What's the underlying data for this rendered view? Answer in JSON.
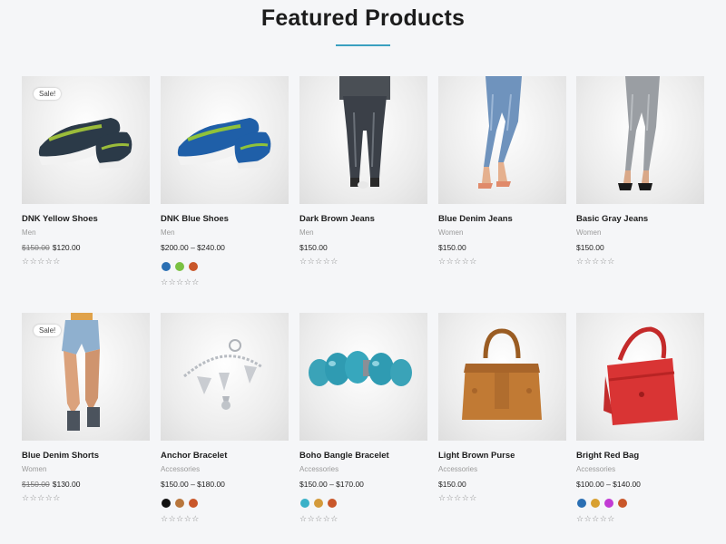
{
  "section": {
    "title": "Featured Products"
  },
  "products": [
    {
      "name": "DNK Yellow Shoes",
      "category": "Men",
      "old_price": "$150.00",
      "price": "$120.00",
      "sale": "Sale!",
      "rating_stars": "☆☆☆☆☆",
      "swatches": []
    },
    {
      "name": "DNK Blue Shoes",
      "category": "Men",
      "price": "$200.00 – $240.00",
      "rating_stars": "☆☆☆☆☆",
      "swatches": [
        "#2a6fb3",
        "#7ac142",
        "#c9572a"
      ]
    },
    {
      "name": "Dark Brown Jeans",
      "category": "Men",
      "price": "$150.00",
      "rating_stars": "☆☆☆☆☆",
      "swatches": []
    },
    {
      "name": "Blue Denim Jeans",
      "category": "Women",
      "price": "$150.00",
      "rating_stars": "☆☆☆☆☆",
      "swatches": []
    },
    {
      "name": "Basic Gray Jeans",
      "category": "Women",
      "price": "$150.00",
      "rating_stars": "☆☆☆☆☆",
      "swatches": []
    },
    {
      "name": "Blue Denim Shorts",
      "category": "Women",
      "old_price": "$150.00",
      "price": "$130.00",
      "sale": "Sale!",
      "rating_stars": "☆☆☆☆☆",
      "swatches": []
    },
    {
      "name": "Anchor Bracelet",
      "category": "Accessories",
      "price": "$150.00 – $180.00",
      "rating_stars": "☆☆☆☆☆",
      "swatches": [
        "#111111",
        "#b8763c",
        "#c9572a"
      ]
    },
    {
      "name": "Boho Bangle Bracelet",
      "category": "Accessories",
      "price": "$150.00 – $170.00",
      "rating_stars": "☆☆☆☆☆",
      "swatches": [
        "#3ab1c8",
        "#d49a3a",
        "#c9572a"
      ]
    },
    {
      "name": "Light Brown Purse",
      "category": "Accessories",
      "price": "$150.00",
      "rating_stars": "☆☆☆☆☆",
      "swatches": []
    },
    {
      "name": "Bright Red Bag",
      "category": "Accessories",
      "price": "$100.00 – $140.00",
      "rating_stars": "☆☆☆☆☆",
      "swatches": [
        "#2a6fb3",
        "#d8a030",
        "#c23bd4",
        "#c9572a"
      ]
    }
  ]
}
